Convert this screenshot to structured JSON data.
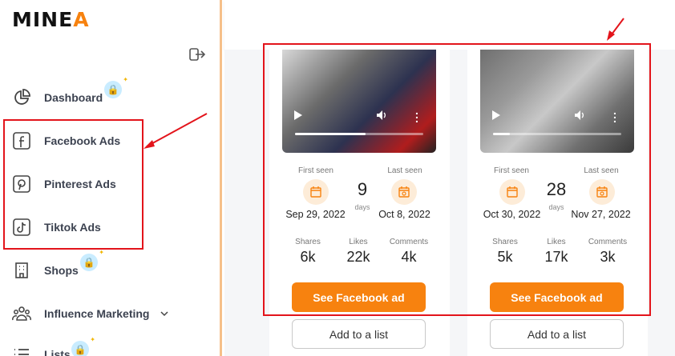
{
  "app": {
    "logo_main": "MINE",
    "logo_accent": "A"
  },
  "sidebar": {
    "items": [
      {
        "label": "Dashboard",
        "icon": "pie-chart-icon",
        "locked": true
      },
      {
        "label": "Facebook Ads",
        "icon": "facebook-icon",
        "locked": false
      },
      {
        "label": "Pinterest Ads",
        "icon": "pinterest-icon",
        "locked": false
      },
      {
        "label": "Tiktok Ads",
        "icon": "tiktok-icon",
        "locked": false
      },
      {
        "label": "Shops",
        "icon": "building-icon",
        "locked": true
      },
      {
        "label": "Influence Marketing",
        "icon": "people-icon",
        "locked": false
      },
      {
        "label": "Lists",
        "icon": "list-icon",
        "locked": true
      }
    ]
  },
  "cards": [
    {
      "first_seen_label": "First seen",
      "last_seen_label": "Last seen",
      "days": "9",
      "days_label": "days",
      "first_seen": "Sep 29, 2022",
      "last_seen": "Oct 8, 2022",
      "shares_label": "Shares",
      "likes_label": "Likes",
      "comments_label": "Comments",
      "shares": "6k",
      "likes": "22k",
      "comments": "4k",
      "video_progress": 0.55,
      "cta": "See Facebook ad",
      "add": "Add to a list"
    },
    {
      "first_seen_label": "First seen",
      "last_seen_label": "Last seen",
      "days": "28",
      "days_label": "days",
      "first_seen": "Oct 30, 2022",
      "last_seen": "Nov 27, 2022",
      "shares_label": "Shares",
      "likes_label": "Likes",
      "comments_label": "Comments",
      "shares": "5k",
      "likes": "17k",
      "comments": "3k",
      "video_progress": 0.13,
      "cta": "See Facebook ad",
      "add": "Add to a list"
    }
  ],
  "colors": {
    "accent": "#f7820f",
    "annotation": "#e3141b",
    "lock_bg": "#c9ecff"
  }
}
